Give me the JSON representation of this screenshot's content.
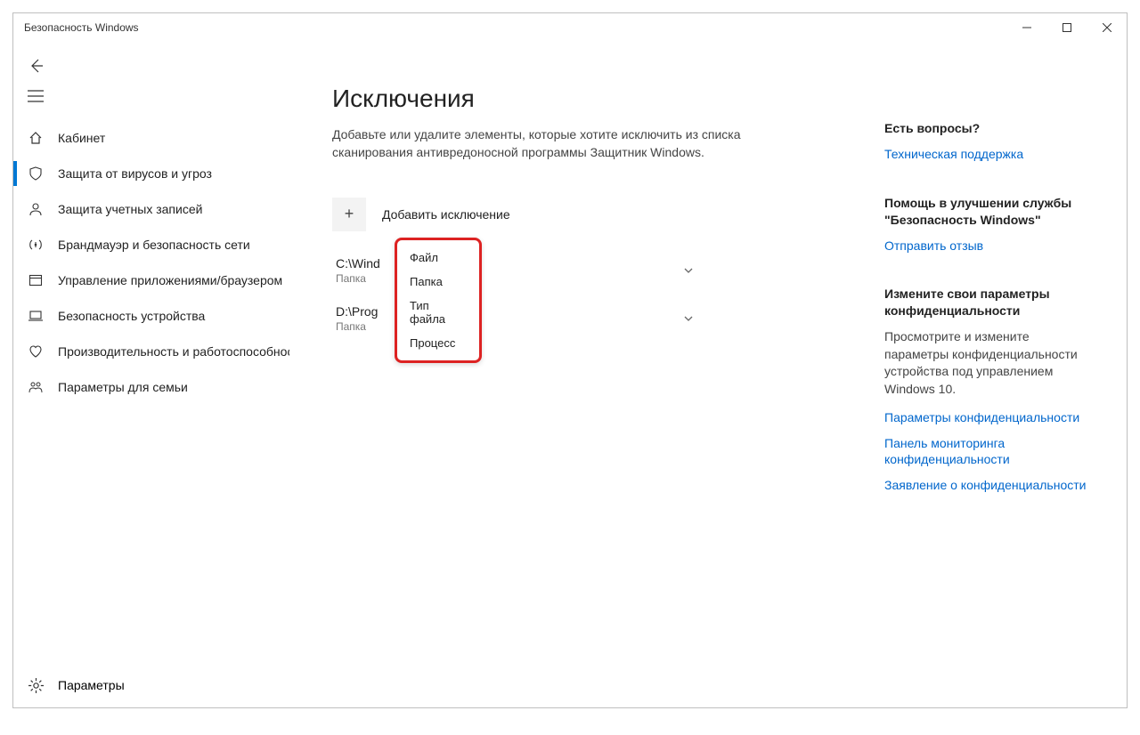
{
  "window": {
    "title": "Безопасность Windows"
  },
  "sidebar": {
    "items": [
      {
        "label": "Кабинет"
      },
      {
        "label": "Защита от вирусов и угроз"
      },
      {
        "label": "Защита учетных записей"
      },
      {
        "label": "Брандмауэр и безопасность сети"
      },
      {
        "label": "Управление приложениями/браузером"
      },
      {
        "label": "Безопасность устройства"
      },
      {
        "label": "Производительность и работоспособность устройства"
      },
      {
        "label": "Параметры для семьи"
      }
    ],
    "settings_label": "Параметры"
  },
  "page": {
    "title": "Исключения",
    "description": "Добавьте или удалите элементы, которые хотите исключить из списка сканирования антивредоносной программы Защитник Windows.",
    "add_label": "Добавить исключение",
    "exclusions": [
      {
        "name": "C:\\Wind",
        "type": "Папка"
      },
      {
        "name": "D:\\Prog",
        "type": "Папка"
      }
    ]
  },
  "dropdown": {
    "items": [
      "Файл",
      "Папка",
      "Тип файла",
      "Процесс"
    ]
  },
  "right": {
    "questions": {
      "heading": "Есть вопросы?",
      "link": "Техническая поддержка"
    },
    "feedback": {
      "heading": "Помощь в улучшении службы \"Безопасность Windows\"",
      "link": "Отправить отзыв"
    },
    "privacy": {
      "heading": "Измените свои параметры конфиденциальности",
      "text": "Просмотрите и измените параметры конфиденциальности устройства под управлением Windows 10.",
      "links": [
        "Параметры конфиденциальности",
        "Панель мониторинга конфиденциальности",
        "Заявление о конфиденциальности"
      ]
    }
  }
}
